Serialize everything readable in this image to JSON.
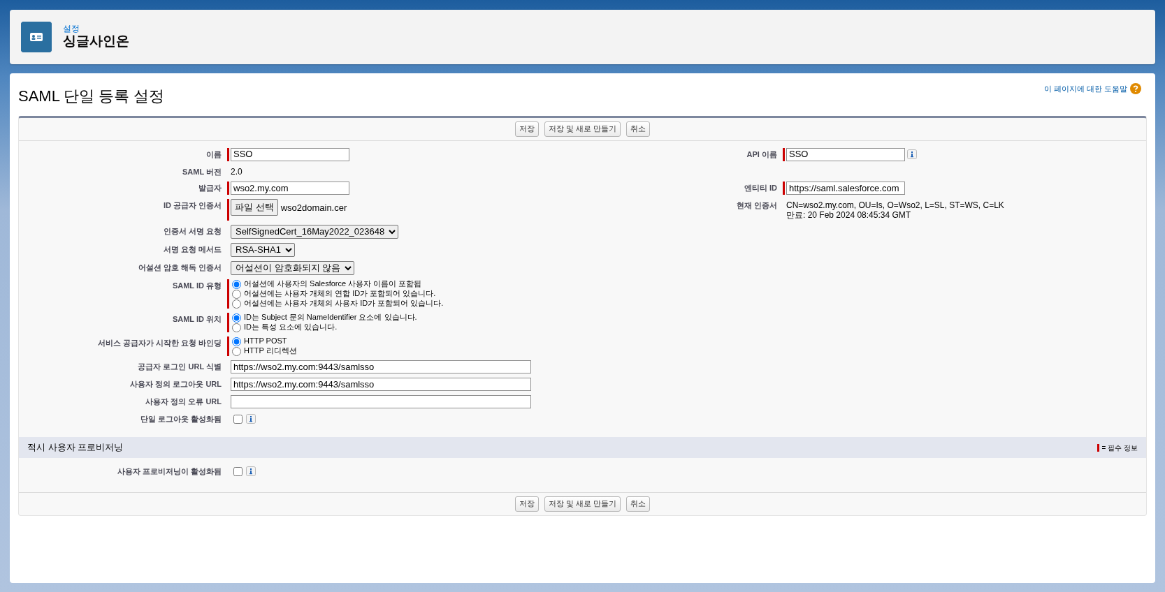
{
  "header": {
    "breadcrumb": "설정",
    "title": "싱글사인온"
  },
  "page": {
    "title": "SAML 단일 등록 설정",
    "help_link": "이 페이지에 대한 도움말"
  },
  "buttons": [
    {
      "label": "저장"
    },
    {
      "label": "저장 및 새로 만들기"
    },
    {
      "label": "취소"
    }
  ],
  "rows": [
    {
      "left": {
        "label": "이름",
        "kind": "text",
        "value": "SSO",
        "required": true
      },
      "right": {
        "label": "API 이름",
        "kind": "text",
        "value": "SSO",
        "required": true,
        "info": true
      }
    },
    {
      "left": {
        "label": "SAML 버전",
        "kind": "static",
        "lines": [
          "2.0"
        ]
      }
    },
    {
      "left": {
        "label": "발급자",
        "kind": "text",
        "value": "wso2.my.com",
        "required": true
      },
      "right": {
        "label": "엔티티 ID",
        "kind": "text",
        "value": "https://saml.salesforce.com",
        "required": true
      }
    },
    {
      "left": {
        "label": "ID 공급자 인증서",
        "kind": "file",
        "button": "파일 선택",
        "value": "wso2domain.cer",
        "required": true
      },
      "right": {
        "label": "현재 인증서",
        "kind": "static",
        "lines": [
          "CN=wso2.my.com, OU=Is, O=Wso2, L=SL, ST=WS, C=LK",
          "만료: 20 Feb 2024 08:45:34 GMT"
        ]
      }
    },
    {
      "left": {
        "label": "인증서 서명 요청",
        "kind": "select",
        "value": "SelfSignedCert_16May2022_023648"
      }
    },
    {
      "left": {
        "label": "서명 요청 메서드",
        "kind": "select",
        "value": "RSA-SHA1"
      }
    },
    {
      "left": {
        "label": "어설션 암호 해독 인증서",
        "kind": "select",
        "value": "어설션이 암호화되지 않음"
      }
    },
    {
      "left": {
        "label": "SAML ID 유형",
        "kind": "radio",
        "required": true,
        "options": [
          {
            "label": "어설션에 사용자의 Salesforce 사용자 이름이 포함됨",
            "selected": true
          },
          {
            "label": "어설션에는 사용자 개체의 연합 ID가 포함되어 있습니다.",
            "selected": false
          },
          {
            "label": "어설션에는 사용자 개체의 사용자 ID가 포함되어 있습니다.",
            "selected": false
          }
        ]
      }
    },
    {
      "left": {
        "label": "SAML ID 위치",
        "kind": "radio",
        "required": true,
        "options": [
          {
            "label": "ID는 Subject 문의 NameIdentifier 요소에 있습니다.",
            "selected": true
          },
          {
            "label": "ID는 특성 요소에 있습니다.",
            "selected": false
          }
        ]
      }
    },
    {
      "left": {
        "label": "서비스 공급자가 시작한 요청 바인딩",
        "kind": "radio",
        "required": true,
        "options": [
          {
            "label": "HTTP POST",
            "selected": true
          },
          {
            "label": "HTTP 리디렉션",
            "selected": false
          }
        ]
      }
    },
    {
      "left": {
        "label": "공급자 로그인 URL 식별",
        "kind": "long-text",
        "value": "https://wso2.my.com:9443/samlsso"
      }
    },
    {
      "left": {
        "label": "사용자 정의 로그아웃 URL",
        "kind": "long-text",
        "value": "https://wso2.my.com:9443/samlsso"
      }
    },
    {
      "left": {
        "label": "사용자 정의 오류 URL",
        "kind": "long-text"
      }
    },
    {
      "left": {
        "label": "단일 로그아웃 활성화됨",
        "kind": "checkbox",
        "checked": false,
        "info": true
      }
    }
  ],
  "section": {
    "title": "적시 사용자 프로비저닝",
    "legend": "= 필수 정보"
  },
  "section_rows": [
    {
      "left": {
        "label": "사용자 프로비저닝이 활성화됨",
        "kind": "checkbox",
        "checked": false,
        "info": true
      }
    }
  ],
  "bottom_buttons": [
    {
      "label": "저장"
    },
    {
      "label": "저장 및 새로 만들기"
    },
    {
      "label": "취소"
    }
  ]
}
